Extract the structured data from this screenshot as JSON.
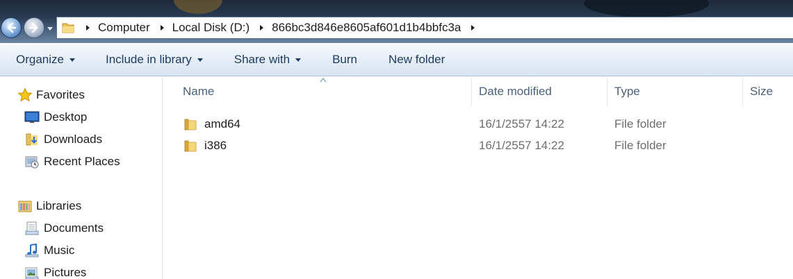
{
  "address_bar": {
    "crumbs": [
      "Computer",
      "Local Disk (D:)",
      "866bc3d846e8605af601d1b4bbfc3a"
    ]
  },
  "toolbar": {
    "organize": "Organize",
    "include_in_library": "Include in library",
    "share_with": "Share with",
    "burn": "Burn",
    "new_folder": "New folder"
  },
  "nav_pane": {
    "favorites": {
      "label": "Favorites",
      "items": [
        "Desktop",
        "Downloads",
        "Recent Places"
      ]
    },
    "libraries": {
      "label": "Libraries",
      "items": [
        "Documents",
        "Music",
        "Pictures"
      ]
    }
  },
  "columns": {
    "name": "Name",
    "date_modified": "Date modified",
    "type": "Type",
    "size": "Size"
  },
  "files": [
    {
      "name": "amd64",
      "date": "16/1/2557 14:22",
      "type": "File folder",
      "icon": "folder-icon"
    },
    {
      "name": "i386",
      "date": "16/1/2557 14:22",
      "type": "File folder",
      "icon": "folder-icon"
    }
  ],
  "colors": {
    "command_text": "#1e3a5f",
    "header_text": "#4c607a",
    "secondary_text": "#6d6d6d"
  }
}
